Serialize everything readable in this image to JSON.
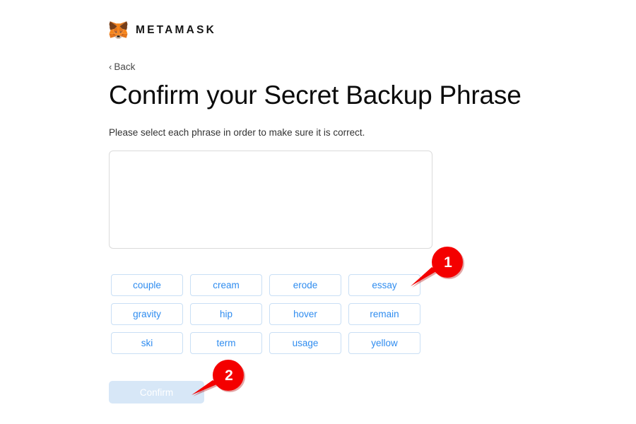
{
  "brand": {
    "logo_icon": "metamask-fox-icon",
    "wordmark": "METAMASK"
  },
  "nav": {
    "back_chevron_icon": "chevron-left-icon",
    "back_label": "Back"
  },
  "header": {
    "title": "Confirm your Secret Backup Phrase",
    "subtitle": "Please select each phrase in order to make sure it is correct."
  },
  "selected_phrase_box": {
    "words": [],
    "placeholder": ""
  },
  "word_chips": [
    {
      "label": "couple"
    },
    {
      "label": "cream"
    },
    {
      "label": "erode"
    },
    {
      "label": "essay"
    },
    {
      "label": "gravity"
    },
    {
      "label": "hip"
    },
    {
      "label": "hover"
    },
    {
      "label": "remain"
    },
    {
      "label": "ski"
    },
    {
      "label": "term"
    },
    {
      "label": "usage"
    },
    {
      "label": "yellow"
    }
  ],
  "actions": {
    "confirm_label": "Confirm",
    "confirm_disabled": true
  },
  "annotations": [
    {
      "number": "1",
      "target": "essay"
    },
    {
      "number": "2",
      "target": "Confirm"
    }
  ],
  "colors": {
    "accent_blue": "#2f8cef",
    "chip_border": "#c9dff5",
    "disabled_button_bg": "#d7e7f7",
    "marker_red": "#f40000",
    "fox_orange": "#e88430",
    "fox_dark": "#763e1a",
    "text_dark": "#0b0b0b"
  }
}
